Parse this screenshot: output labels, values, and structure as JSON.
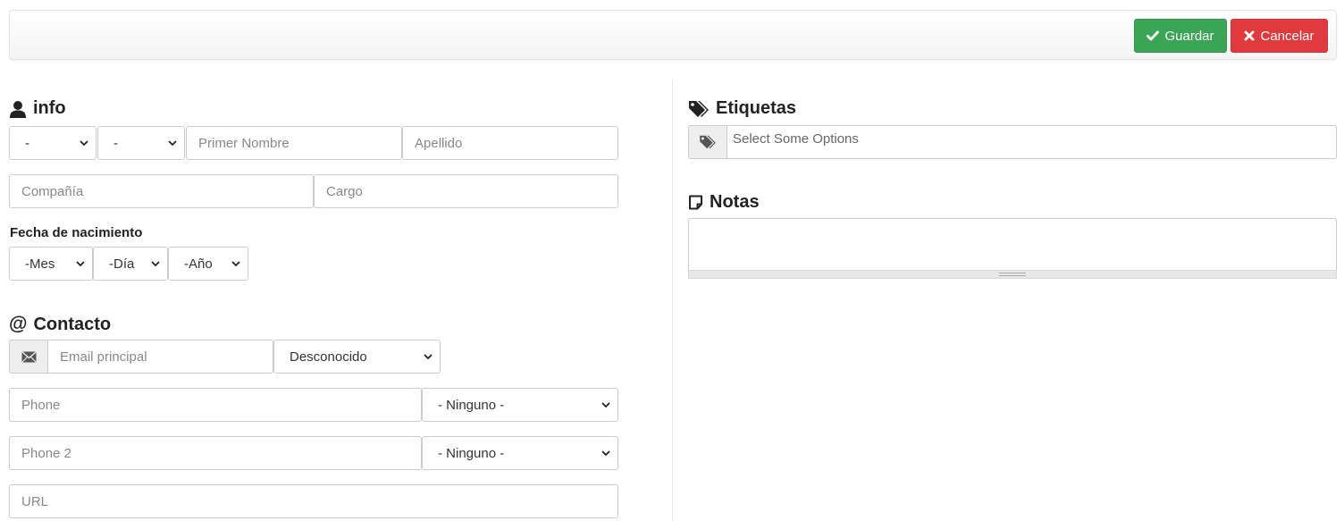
{
  "toolbar": {
    "save_label": "Guardar",
    "cancel_label": "Cancelar",
    "save_color": "#3aa655",
    "cancel_color": "#e0393e"
  },
  "info": {
    "title": "info",
    "icon": "user-icon",
    "salutation_value": "-",
    "suffix_value": "-",
    "first_name_placeholder": "Primer Nombre",
    "last_name_placeholder": "Apellido",
    "company_placeholder": "Compañía",
    "position_placeholder": "Cargo",
    "birthdate_label": "Fecha de nacimiento",
    "month_value": "-Mes",
    "day_value": "-Día",
    "year_value": "-Año"
  },
  "contact": {
    "title": "Contacto",
    "icon": "at-icon",
    "email_placeholder": "Email principal",
    "email_type_value": "Desconocido",
    "phone_placeholder": "Phone",
    "phone_type_value": "- Ninguno -",
    "phone2_placeholder": "Phone 2",
    "phone2_type_value": "- Ninguno -",
    "url_placeholder": "URL"
  },
  "tags": {
    "title": "Etiquetas",
    "icon": "tags-icon",
    "placeholder": "Select Some Options"
  },
  "notes": {
    "title": "Notas",
    "icon": "note-icon"
  }
}
